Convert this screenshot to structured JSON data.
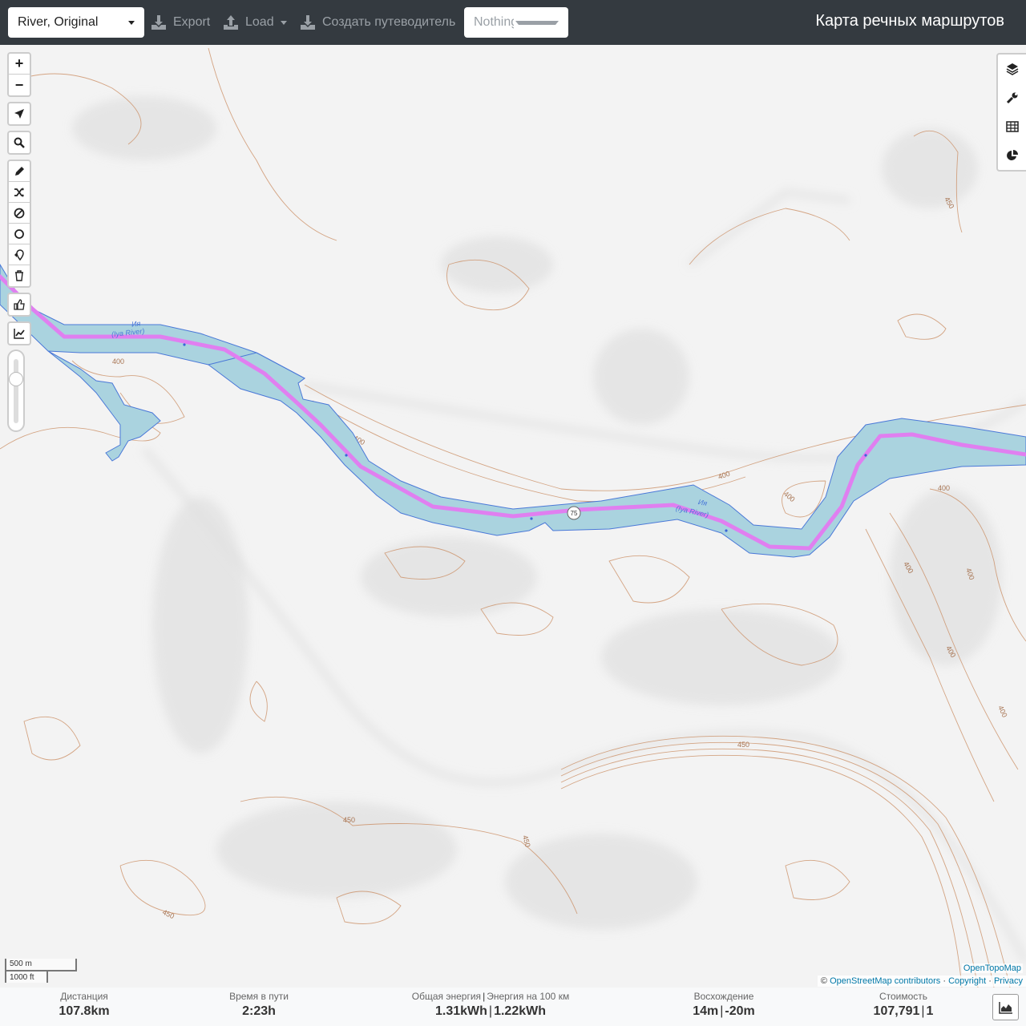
{
  "navbar": {
    "profile": "River, Original",
    "export_label": "Export",
    "load_label": "Load",
    "guide_label": "Создать путеводитель",
    "selection_placeholder": "Nothing selected",
    "title": "Карта речных маршрутов"
  },
  "map": {
    "labels": {
      "river_ru": "Ия",
      "river_en": "(Iya River)",
      "route_ref": "75",
      "contours": [
        "400",
        "400",
        "400",
        "400",
        "400",
        "400",
        "400",
        "400",
        "450",
        "450",
        "450",
        "450",
        "450",
        "400"
      ]
    },
    "scale": {
      "metric": "500 m",
      "imperial": "1000 ft"
    },
    "attribution": {
      "provider": "OpenTopoMap",
      "prefix": "©",
      "osm": "OpenStreetMap contributors",
      "dot": "·",
      "copyright": "Copyright",
      "privacy": "Privacy"
    },
    "colors": {
      "water": "#aad3df",
      "route": "#e07ff0",
      "contour": "#c98a5e",
      "background": "#f3f3f3"
    }
  },
  "controls": {
    "zoom_in": "+",
    "zoom_out": "−",
    "left_icons": [
      "locate-icon",
      "search-icon",
      "pencil-icon",
      "shuffle-icon",
      "no-entry-icon",
      "circle-icon",
      "poi-icon",
      "trash-icon",
      "thumb-icon",
      "chart-line-icon"
    ],
    "right_icons": [
      "layers-icon",
      "wrench-icon",
      "table-icon",
      "pie-chart-icon"
    ]
  },
  "stats": {
    "distance": {
      "label": "Дистанция",
      "value": "107.8",
      "unit": "km"
    },
    "time": {
      "label": "Время в пути",
      "value": "2:23",
      "unit": "h"
    },
    "energy": {
      "label": "Общая энергия",
      "label2": "Энергия на 100 км",
      "sep": "|",
      "value": "1.31",
      "unit": "kWh",
      "value2": "1.22",
      "unit2": "kWh"
    },
    "ascent": {
      "label": "Восхождение",
      "value": "14",
      "unit": "m",
      "sep": "|",
      "value2": "-20",
      "unit2": "m"
    },
    "cost": {
      "label": "Стоимость",
      "value": "107,791",
      "sep": "|",
      "value2": "1"
    }
  }
}
